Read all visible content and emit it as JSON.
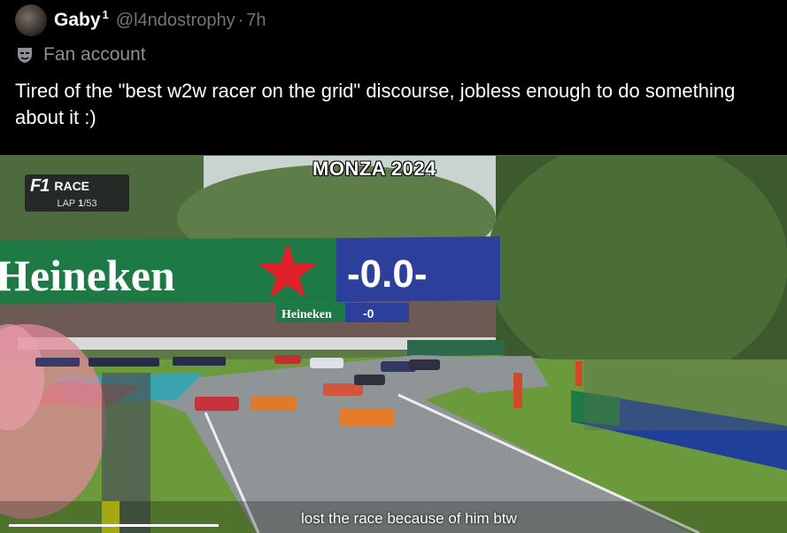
{
  "author": {
    "name": "Gaby",
    "badge": "1",
    "handle": "@l4ndostrophy",
    "separator": "·",
    "time": "7h"
  },
  "label": {
    "icon": "mask-icon",
    "text": "Fan account"
  },
  "tweet": {
    "text": "Tired of the \"best w2w racer on the grid\" discourse, jobless enough to do something about it :)"
  },
  "video": {
    "overlay_title": "MONZA 2024",
    "f1_logo": "F1",
    "f1_race": "RACE",
    "lap_prefix": "LAP ",
    "lap_current": "1",
    "lap_total": "/53",
    "banner_brand": "Heineken",
    "banner_zero": "-0.0-",
    "banner_small_brand": "Heineken",
    "banner_small_zero": "-0",
    "caption": "lost the race because of him btw",
    "progress": 0.27
  },
  "colors": {
    "background": "#000000",
    "text": "#ffffff",
    "muted": "#71767b",
    "banner_green": "#1d7a45",
    "banner_blue": "#2c3f9a",
    "banner_star": "#e0202a"
  }
}
